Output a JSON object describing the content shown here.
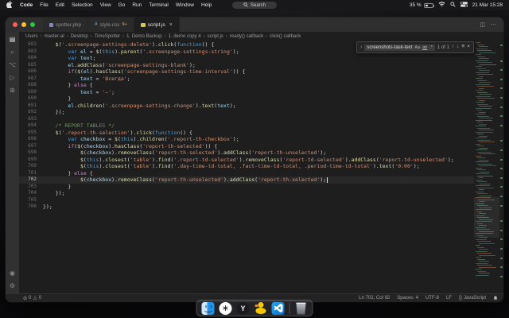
{
  "colors": {
    "string_token": "#ce9178",
    "keyword_token": "#569cd6",
    "control_token": "#c586c0",
    "function_token": "#dcdcaa",
    "variable_token": "#9cdcfe",
    "comment_token": "#6a9955",
    "traffic_close": "#ff5f57",
    "traffic_minimize": "#febc2e",
    "traffic_zoom": "#28c840",
    "vscode_brand_blue": "#0b6fc2",
    "ruler_change_green": "#55b06a"
  },
  "menu_bar": {
    "app_menus": [
      "Code",
      "File",
      "Edit",
      "Selection",
      "View",
      "Go",
      "Run",
      "Terminal",
      "Window",
      "Help"
    ],
    "search_pill_label": "Search",
    "battery_percent": "35 %",
    "clock": "21 Mar 15:28"
  },
  "tabs": [
    {
      "label": "spotter.php",
      "icon": "php",
      "badge": "",
      "active": false
    },
    {
      "label": "style.css",
      "icon": "css",
      "badge": "9+",
      "active": false
    },
    {
      "label": "script.js",
      "icon": "js",
      "badge": "",
      "active": true
    }
  ],
  "breadcrumbs": [
    "Users",
    "master-al",
    "Desktop",
    "TimeSpotter",
    "1. Demo Backup",
    "1. demo copy 4",
    "script.js",
    "ready() callback",
    "click() callback"
  ],
  "find_widget": {
    "query": "screenshots-task-text",
    "match_case": "Aa",
    "whole_word": "ab",
    "regex": ".*",
    "results": "1 of 1"
  },
  "activity_bar": [
    {
      "name": "explorer-icon",
      "glyph": "▤"
    },
    {
      "name": "search-icon",
      "glyph": "⌕"
    },
    {
      "name": "source-control-icon",
      "glyph": "⌥"
    },
    {
      "name": "run-debug-icon",
      "glyph": "▷"
    },
    {
      "name": "extensions-icon",
      "glyph": "⊞"
    }
  ],
  "activity_bar_bottom": [
    {
      "name": "account-icon",
      "glyph": "◉"
    },
    {
      "name": "settings-gear-icon",
      "glyph": "⚙"
    }
  ],
  "editor": {
    "lines": [
      {
        "n": 682,
        "tok": [
          [
            "pln",
            "    "
          ],
          [
            "fn",
            "$"
          ],
          [
            "pun",
            "("
          ],
          [
            "str",
            "'.screenpage-settings-delete'"
          ],
          [
            "pun",
            ")."
          ],
          [
            "fn",
            "click"
          ],
          [
            "pun",
            "("
          ],
          [
            "kw",
            "function"
          ],
          [
            "pun",
            "() {"
          ]
        ]
      },
      {
        "n": 683,
        "tok": [
          [
            "pln",
            "        "
          ],
          [
            "kw",
            "var"
          ],
          [
            "pln",
            " "
          ],
          [
            "idf",
            "el"
          ],
          [
            "pun",
            " = "
          ],
          [
            "fn",
            "$"
          ],
          [
            "pun",
            "("
          ],
          [
            "kw",
            "this"
          ],
          [
            "pun",
            ")."
          ],
          [
            "fn",
            "parent"
          ],
          [
            "pun",
            "("
          ],
          [
            "str",
            "'.screenpage-settings-string'"
          ],
          [
            "pun",
            ");"
          ]
        ]
      },
      {
        "n": 684,
        "tok": [
          [
            "pln",
            "        "
          ],
          [
            "kw",
            "var"
          ],
          [
            "pln",
            " "
          ],
          [
            "idf",
            "text"
          ],
          [
            "pun",
            ";"
          ]
        ]
      },
      {
        "n": 685,
        "tok": [
          [
            "pln",
            "        "
          ],
          [
            "idf",
            "el"
          ],
          [
            "pun",
            "."
          ],
          [
            "fn",
            "addClass"
          ],
          [
            "pun",
            "("
          ],
          [
            "str",
            "'screenpage-settings-blank'"
          ],
          [
            "pun",
            ");"
          ]
        ]
      },
      {
        "n": 686,
        "tok": [
          [
            "pln",
            "        "
          ],
          [
            "kwc",
            "if"
          ],
          [
            "pun",
            "("
          ],
          [
            "fn",
            "$"
          ],
          [
            "pun",
            "("
          ],
          [
            "idf",
            "el"
          ],
          [
            "pun",
            ")."
          ],
          [
            "fn",
            "hasClass"
          ],
          [
            "pun",
            "("
          ],
          [
            "str",
            "'screenpage-settings-time-interval'"
          ],
          [
            "pun",
            ")) {"
          ]
        ]
      },
      {
        "n": 687,
        "tok": [
          [
            "pln",
            "            "
          ],
          [
            "idf",
            "text"
          ],
          [
            "pun",
            " = "
          ],
          [
            "str",
            "'Всегда'"
          ],
          [
            "pun",
            ";"
          ]
        ]
      },
      {
        "n": 688,
        "tok": [
          [
            "pln",
            "        "
          ],
          [
            "pun",
            "} "
          ],
          [
            "kwc",
            "else"
          ],
          [
            "pun",
            " {"
          ]
        ]
      },
      {
        "n": 689,
        "tok": [
          [
            "pln",
            "            "
          ],
          [
            "idf",
            "text"
          ],
          [
            "pun",
            " = "
          ],
          [
            "str",
            "'—'"
          ],
          [
            "pun",
            ";"
          ]
        ]
      },
      {
        "n": 690,
        "tok": [
          [
            "pln",
            "        "
          ],
          [
            "pun",
            "}"
          ]
        ]
      },
      {
        "n": 691,
        "tok": [
          [
            "pln",
            "        "
          ],
          [
            "idf",
            "el"
          ],
          [
            "pun",
            "."
          ],
          [
            "fn",
            "children"
          ],
          [
            "pun",
            "("
          ],
          [
            "str",
            "'.screenpage-settings-change'"
          ],
          [
            "pun",
            ")."
          ],
          [
            "fn",
            "text"
          ],
          [
            "pun",
            "("
          ],
          [
            "idf",
            "text"
          ],
          [
            "pun",
            ");"
          ]
        ]
      },
      {
        "n": 692,
        "tok": [
          [
            "pln",
            "    "
          ],
          [
            "pun",
            "});"
          ]
        ]
      },
      {
        "n": 693,
        "tok": []
      },
      {
        "n": 694,
        "tok": [
          [
            "pln",
            "    "
          ],
          [
            "com",
            "/* REPORT TABLES */"
          ]
        ]
      },
      {
        "n": 695,
        "tok": [
          [
            "pln",
            "    "
          ],
          [
            "fn",
            "$"
          ],
          [
            "pun",
            "("
          ],
          [
            "str",
            "'.report-th-selection'"
          ],
          [
            "pun",
            ")."
          ],
          [
            "fn",
            "click"
          ],
          [
            "pun",
            "("
          ],
          [
            "kw",
            "function"
          ],
          [
            "pun",
            "() {"
          ]
        ]
      },
      {
        "n": 696,
        "tok": [
          [
            "pln",
            "        "
          ],
          [
            "kw",
            "var"
          ],
          [
            "pln",
            " "
          ],
          [
            "idf",
            "checkbox"
          ],
          [
            "pun",
            " = "
          ],
          [
            "fn",
            "$"
          ],
          [
            "pun",
            "("
          ],
          [
            "kw",
            "this"
          ],
          [
            "pun",
            ")."
          ],
          [
            "fn",
            "children"
          ],
          [
            "pun",
            "("
          ],
          [
            "str",
            "'.report-th-checkbox'"
          ],
          [
            "pun",
            ");"
          ]
        ]
      },
      {
        "n": 697,
        "tok": [
          [
            "pln",
            "        "
          ],
          [
            "kwc",
            "if"
          ],
          [
            "pun",
            "("
          ],
          [
            "fn",
            "$"
          ],
          [
            "pun",
            "("
          ],
          [
            "idf",
            "checkbox"
          ],
          [
            "pun",
            ")."
          ],
          [
            "fn",
            "hasClass"
          ],
          [
            "pun",
            "("
          ],
          [
            "str",
            "'report-th-selected'"
          ],
          [
            "pun",
            ")) {"
          ]
        ]
      },
      {
        "n": 698,
        "tok": [
          [
            "pln",
            "            "
          ],
          [
            "fn",
            "$"
          ],
          [
            "pun",
            "("
          ],
          [
            "idf",
            "checkbox"
          ],
          [
            "pun",
            ")."
          ],
          [
            "fn",
            "removeClass"
          ],
          [
            "pun",
            "("
          ],
          [
            "str",
            "'report-th-selected'"
          ],
          [
            "pun",
            ")."
          ],
          [
            "fn",
            "addClass"
          ],
          [
            "pun",
            "("
          ],
          [
            "str",
            "'report-th-unselected'"
          ],
          [
            "pun",
            ");"
          ]
        ]
      },
      {
        "n": 699,
        "tok": [
          [
            "pln",
            "            "
          ],
          [
            "fn",
            "$"
          ],
          [
            "pun",
            "("
          ],
          [
            "kw",
            "this"
          ],
          [
            "pun",
            ")."
          ],
          [
            "fn",
            "closest"
          ],
          [
            "pun",
            "("
          ],
          [
            "str",
            "'table'"
          ],
          [
            "pun",
            ")."
          ],
          [
            "fn",
            "find"
          ],
          [
            "pun",
            "("
          ],
          [
            "str",
            "'.report-td-selected'"
          ],
          [
            "pun",
            ")."
          ],
          [
            "fn",
            "removeClass"
          ],
          [
            "pun",
            "("
          ],
          [
            "str",
            "'report-td-selected'"
          ],
          [
            "pun",
            ")."
          ],
          [
            "fn",
            "addClass"
          ],
          [
            "pun",
            "("
          ],
          [
            "str",
            "'report-td-unselected'"
          ],
          [
            "pun",
            ");"
          ]
        ]
      },
      {
        "n": 700,
        "tok": [
          [
            "pln",
            "            "
          ],
          [
            "fn",
            "$"
          ],
          [
            "pun",
            "("
          ],
          [
            "kw",
            "this"
          ],
          [
            "pun",
            ")."
          ],
          [
            "fn",
            "closest"
          ],
          [
            "pun",
            "("
          ],
          [
            "str",
            "'table'"
          ],
          [
            "pun",
            ")."
          ],
          [
            "fn",
            "find"
          ],
          [
            "pun",
            "("
          ],
          [
            "str",
            "'.day-time-td-total, .fact-time-td-total, .period-time-td-total'"
          ],
          [
            "pun",
            ")."
          ],
          [
            "fn",
            "text"
          ],
          [
            "pun",
            "("
          ],
          [
            "str",
            "'0:00'"
          ],
          [
            "pun",
            ");"
          ]
        ]
      },
      {
        "n": 701,
        "tok": [
          [
            "pln",
            "        "
          ],
          [
            "pun",
            "} "
          ],
          [
            "kwc",
            "else"
          ],
          [
            "pun",
            " {"
          ]
        ]
      },
      {
        "n": 702,
        "cur": true,
        "tok": [
          [
            "pln",
            "            "
          ],
          [
            "fn",
            "$"
          ],
          [
            "pun",
            "("
          ],
          [
            "idf",
            "checkbox"
          ],
          [
            "pun",
            ")."
          ],
          [
            "fn",
            "removeClass"
          ],
          [
            "pun",
            "("
          ],
          [
            "str",
            "'report-th-unselected'"
          ],
          [
            "pun",
            ")."
          ],
          [
            "fn",
            "addClass"
          ],
          [
            "pun",
            "("
          ],
          [
            "str",
            "'report-th-selected'"
          ],
          [
            "pun",
            ");"
          ]
        ]
      },
      {
        "n": 703,
        "tok": [
          [
            "pln",
            "        "
          ],
          [
            "pun",
            "}"
          ]
        ]
      },
      {
        "n": 704,
        "tok": [
          [
            "pln",
            "    "
          ],
          [
            "pun",
            "});"
          ]
        ]
      },
      {
        "n": 705,
        "tok": []
      },
      {
        "n": 706,
        "tok": [
          [
            "pun",
            "});"
          ]
        ]
      }
    ]
  },
  "status_bar": {
    "errors": "0",
    "warnings": "0",
    "cursor_position": "Ln 702, Col 92",
    "indentation": "Spaces: 4",
    "encoding": "UTF-8",
    "eol": "LF",
    "lang_glyph": "{}",
    "language": "JavaScript"
  },
  "dock": [
    {
      "name": "finder-dock-icon"
    },
    {
      "name": "chatgpt-dock-icon",
      "glyph": "∗"
    },
    {
      "name": "y-app-dock-icon",
      "glyph": "Y"
    },
    {
      "name": "cyberduck-dock-icon"
    },
    {
      "name": "vscode-dock-icon"
    },
    {
      "name": "trash-dock-icon"
    }
  ]
}
